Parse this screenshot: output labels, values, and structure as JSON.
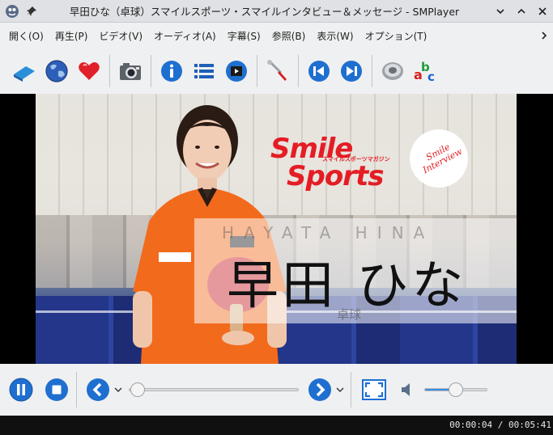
{
  "window": {
    "title": "早田ひな（卓球）スマイルスポーツ・スマイルインタビュー＆メッセージ - SMPlayer"
  },
  "menu": {
    "items": [
      "開く(O)",
      "再生(P)",
      "ビデオ(V)",
      "オーディオ(A)",
      "字幕(S)",
      "参照(B)",
      "表示(W)",
      "オプション(T)"
    ]
  },
  "toolbar": {
    "icons": [
      "book-icon",
      "globe-icon",
      "heart-icon",
      "camera-icon",
      "info-icon",
      "playlist-icon",
      "video-clip-icon",
      "tools-icon",
      "previous-icon",
      "next-icon",
      "speaker-icon",
      "abc-icon"
    ]
  },
  "video": {
    "romaji": "HAYATA HINA",
    "name": "早田 ひな",
    "category": "卓球",
    "logo_line1": "Smile",
    "logo_line2": "Sports",
    "logo_sub": "スマイルスポーツマガジン",
    "badge_line1": "Smile",
    "badge_line2": "Interview"
  },
  "player": {
    "position": "00:00:04",
    "duration": "00:05:41",
    "time_display": "00:00:04 / 00:05:41",
    "progress_fraction": 0.012,
    "volume_fraction": 0.5
  },
  "colors": {
    "accent": "#3d8fe0",
    "brand_red": "#e41d24"
  }
}
